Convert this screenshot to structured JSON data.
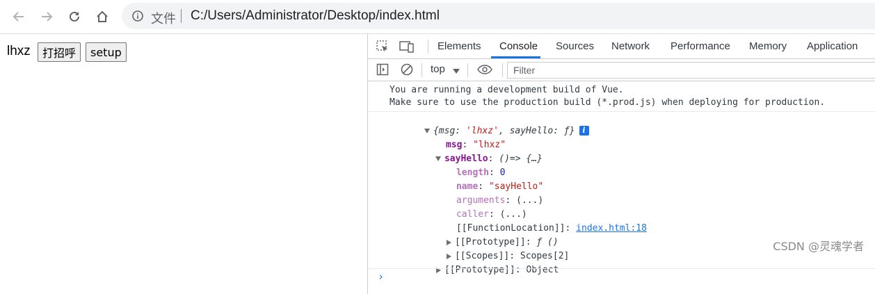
{
  "browser": {
    "url_scheme": "文件",
    "url": "C:/Users/Administrator/Desktop/index.html",
    "icons": [
      "back-icon",
      "forward-icon",
      "reload-icon",
      "home-icon",
      "info-icon"
    ]
  },
  "page": {
    "text": "lhxz",
    "greet_button": "打招呼",
    "setup_button": "setup"
  },
  "devtools": {
    "tabs": [
      "Elements",
      "Console",
      "Sources",
      "Network",
      "Performance",
      "Memory",
      "Application"
    ],
    "active_tab": "Console",
    "context": "top",
    "filter_placeholder": "Filter",
    "accent_color": "#1a73e8"
  },
  "console": {
    "vue_warning": [
      "You are running a development build of Vue.",
      "Make sure to use the production build (*.prod.js) when deploying for production."
    ],
    "object": {
      "summary_open": "{",
      "summary_msg_key": "msg",
      "summary_msg_val": "'lhxz'",
      "summary_mid": ", ",
      "summary_fn_key": "sayHello",
      "summary_fn_val": "ƒ",
      "summary_close": "}",
      "info_badge": "i",
      "msg_key": "msg",
      "msg_val": "\"lhxz\"",
      "fn_key": "sayHello",
      "fn_val": "()=> {…}",
      "length_key": "length",
      "length_val": "0",
      "name_key": "name",
      "name_val": "\"sayHello\"",
      "arguments_key": "arguments",
      "arguments_val": "(...)",
      "caller_key": "caller",
      "caller_val": "(...)",
      "fnloc_key": "[[FunctionLocation]]",
      "fnloc_val": "index.html:18",
      "fnproto_key": "[[Prototype]]",
      "fnproto_val": "ƒ ()",
      "scopes_key": "[[Scopes]]",
      "scopes_val": "Scopes[2]",
      "proto_key": "[[Prototype]]",
      "proto_val": "Object"
    },
    "prompt": "›"
  },
  "watermark": "CSDN @灵魂学者"
}
